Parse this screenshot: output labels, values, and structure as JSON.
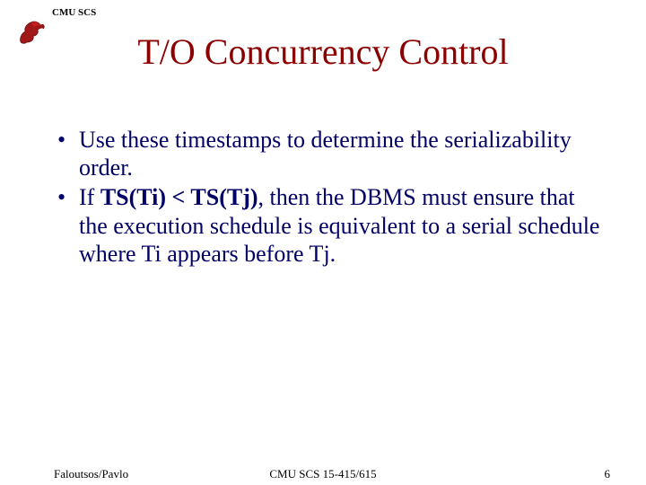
{
  "header": {
    "org_label": "CMU SCS"
  },
  "title": "T/O Concurrency Control",
  "bullets": [
    {
      "pre": "Use these timestamps to determine the serializability order.",
      "bold": "",
      "post": ""
    },
    {
      "pre": "If ",
      "bold": "TS(Ti) < TS(Tj)",
      "post": ", then the DBMS must ensure that the execution schedule is equivalent to a serial schedule where Ti appears before Tj."
    }
  ],
  "footer": {
    "left": "Faloutsos/Pavlo",
    "center": "CMU SCS 15-415/615",
    "right": "6"
  }
}
